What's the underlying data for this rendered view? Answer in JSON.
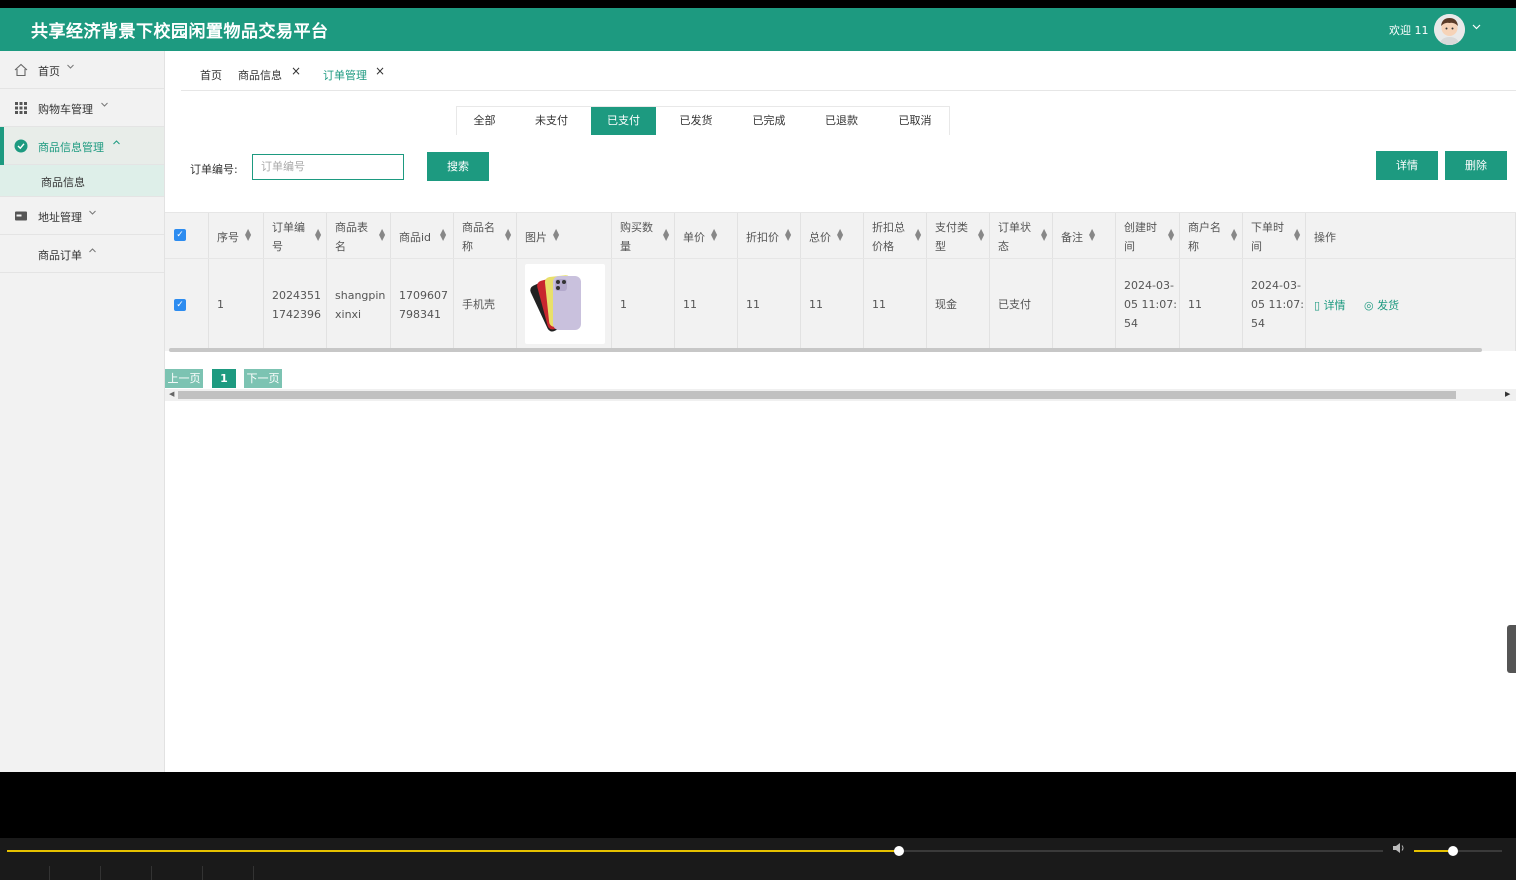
{
  "header": {
    "title": "共享经济背景下校园闲置物品交易平台",
    "welcome": "欢迎 11"
  },
  "sidebar": {
    "items": [
      {
        "label": "首页",
        "icon": "home-icon"
      },
      {
        "label": "购物车管理",
        "icon": "grid-icon"
      },
      {
        "label": "商品信息管理",
        "icon": "check-circle-icon"
      },
      {
        "label": "地址管理",
        "icon": "card-icon"
      },
      {
        "label": "商品订单",
        "icon": ""
      }
    ],
    "sub_items": [
      {
        "label": "商品信息"
      }
    ]
  },
  "nav_tabs": [
    {
      "label": "首页"
    },
    {
      "label": "商品信息"
    },
    {
      "label": "订单管理"
    }
  ],
  "status_tabs": [
    "全部",
    "未支付",
    "已支付",
    "已发货",
    "已完成",
    "已退款",
    "已取消"
  ],
  "search": {
    "label": "订单编号:",
    "placeholder": "订单编号",
    "button": "搜索"
  },
  "actions": {
    "detail": "详情",
    "delete": "删除"
  },
  "table": {
    "columns": [
      [
        "序号"
      ],
      [
        "订单编",
        "号"
      ],
      [
        "商品表",
        "名"
      ],
      [
        "商品id"
      ],
      [
        "商品名",
        "称"
      ],
      [
        "图片"
      ],
      [
        "购买数",
        "量"
      ],
      [
        "单价"
      ],
      [
        "折扣价"
      ],
      [
        "总价"
      ],
      [
        "折扣总",
        "价格"
      ],
      [
        "支付类",
        "型"
      ],
      [
        "订单状",
        "态"
      ],
      [
        "备注"
      ],
      [
        "创建时",
        "间"
      ],
      [
        "商户名",
        "称"
      ],
      [
        "下单时",
        "间"
      ],
      [
        "操作"
      ]
    ],
    "row": {
      "index": "1",
      "order_no": [
        "2024351",
        "1742396"
      ],
      "table_name": [
        "shangpin",
        "xinxi"
      ],
      "goods_id": [
        "1709607",
        "798341"
      ],
      "goods_name": "手机壳",
      "qty": "1",
      "price": "11",
      "discount_price": "11",
      "total": "11",
      "discount_total": "11",
      "pay_type": "现金",
      "status": "已支付",
      "remark": "",
      "created": [
        "2024-03-",
        "05 11:07:",
        "54"
      ],
      "merchant": "11",
      "ordered": [
        "2024-03-",
        "05 11:07:",
        "54"
      ],
      "op_detail": "详情",
      "op_ship": "发货"
    }
  },
  "pager": {
    "prev": "上一页",
    "page": "1",
    "next": "下一页"
  },
  "colors": {
    "accent": "#1d9a80",
    "checkbox": "#2d8cf0",
    "player_progress": "#e6c100"
  },
  "player": {
    "progress_fraction": 0.648,
    "volume_fraction": 0.44
  }
}
